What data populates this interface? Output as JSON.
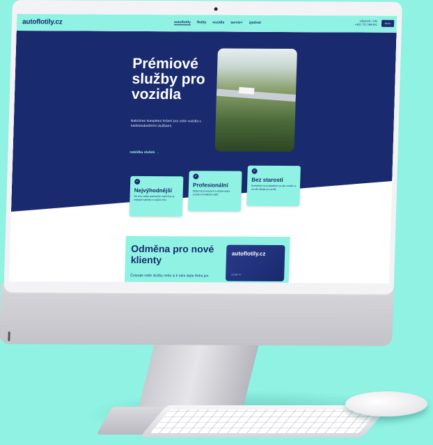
{
  "site": {
    "logo": "autoflotily.cz",
    "nav": [
      "autoflotily",
      "flotily",
      "vozidla",
      "servis+",
      "zjednat"
    ],
    "contact_line1": "zákazník / info",
    "contact_line2": "+420 731 599 801",
    "cta": "MENU"
  },
  "hero": {
    "title": "Prémiové služby pro vozidla",
    "text": "Nabízíme kompletní řešení pro vaše vozidla s nadstandardními službami.",
    "link": "nabídka služeb →"
  },
  "cards": [
    {
      "title": "Nejvýhodnější",
      "text": "Na trhu našim partnerům nabízíme ty nejlepší nabídky z celého trhu."
    },
    {
      "title": "Profesionální",
      "text": "Odborné posouzení a nastavování vozidel s kvalitními péčí."
    },
    {
      "title": "Bez starostí",
      "text": "Kompletní se postaráme za vás vozidlo a nic ale dbejte pro profit."
    }
  ],
  "promo": {
    "title": "Odměna pro nové klienty",
    "text": "Čerpejte naše služby nebo si k nám dejte třeba jen",
    "card_logo": "autoflotily.cz",
    "card_number": "5239 •••"
  },
  "colors": {
    "accent": "#8ff2e3",
    "brand": "#1a2a6e"
  }
}
